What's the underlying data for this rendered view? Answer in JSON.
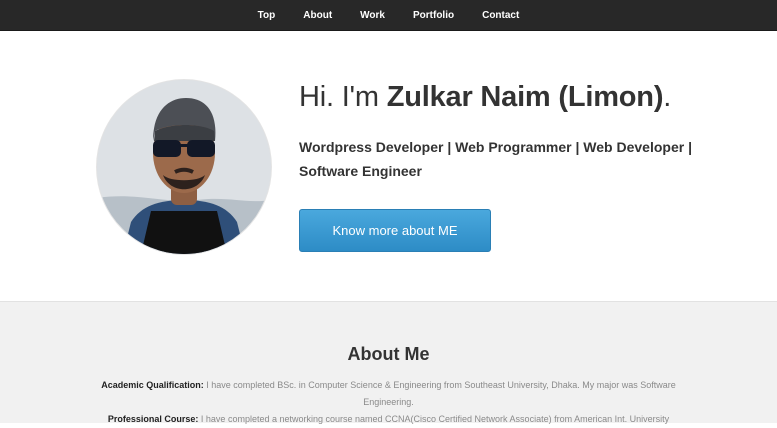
{
  "nav": {
    "items": [
      "Top",
      "About",
      "Work",
      "Portfolio",
      "Contact"
    ]
  },
  "hero": {
    "greeting": "Hi. I'm ",
    "name": "Zulkar Naim (Limon)",
    "end": ".",
    "roles": "Wordpress Developer | Web Programmer | Web Developer | Software Engineer",
    "cta_label": "Know more about ME"
  },
  "about": {
    "title": "About Me",
    "academic_label": "Academic Qualification:",
    "academic_text": " I have completed BSc. in Computer Science & Engineering from Southeast University, Dhaka. My major was Software Engineering.",
    "course_label": "Professional Course:",
    "course_text": " I have completed a networking course named CCNA(Cisco Certified Network Associate) from American Int. University"
  },
  "colors": {
    "nav_bg": "#282828",
    "button": "#3b99d4",
    "about_bg": "#f1f1f1"
  }
}
